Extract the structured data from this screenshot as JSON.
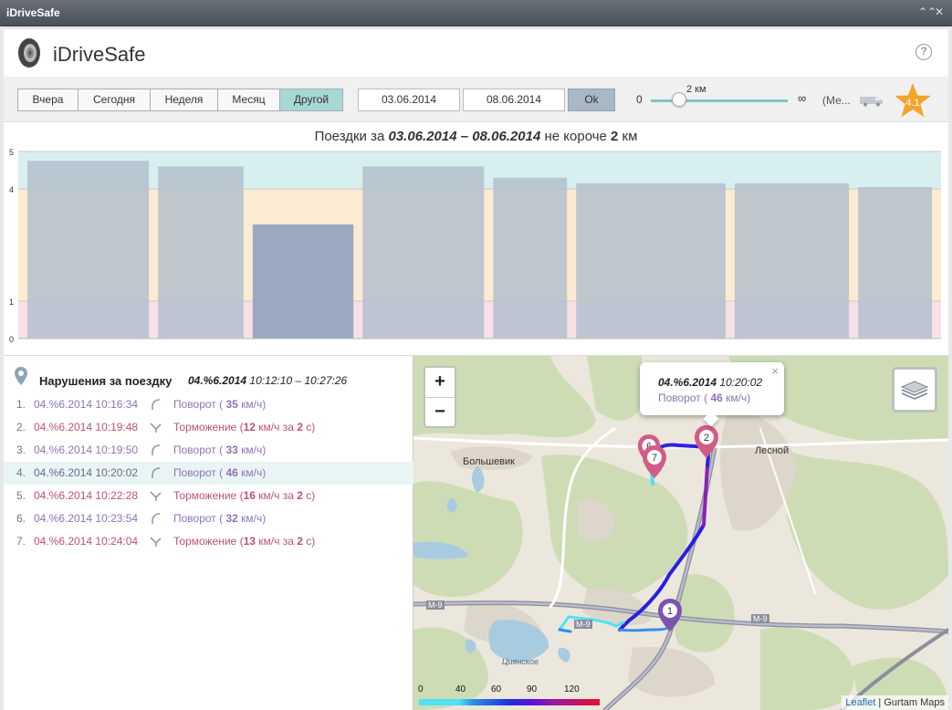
{
  "window": {
    "title": "iDriveSafe",
    "controls": [
      "⌃⌃",
      "✕"
    ]
  },
  "header": {
    "title": "iDriveSafe",
    "help": "?"
  },
  "toolbar": {
    "periods": [
      {
        "label": "Вчера",
        "active": false
      },
      {
        "label": "Сегодня",
        "active": false
      },
      {
        "label": "Неделя",
        "active": false
      },
      {
        "label": "Месяц",
        "active": false
      },
      {
        "label": "Другой",
        "active": true
      }
    ],
    "date_from": "03.06.2014",
    "date_to": "08.06.2014",
    "ok_label": "Ok",
    "slider": {
      "min_label": "0",
      "max_label": "∞",
      "value_label": "2 км",
      "fraction": 0.2
    },
    "vehicle_label": "(Ме...",
    "score": "4.1"
  },
  "chart": {
    "title_prefix": "Поездки за ",
    "title_range": "03.06.2014 – 08.06.2014",
    "title_middle": " не короче ",
    "title_distance": "2",
    "title_suffix": " км"
  },
  "chart_data": {
    "type": "bar",
    "title": "Поездки за 03.06.2014 – 08.06.2014 не короче 2 км",
    "y_ticks": [
      0,
      1,
      4,
      5
    ],
    "ylim": [
      0,
      5
    ],
    "bands": [
      {
        "from": 0,
        "to": 1,
        "color": "#f9dfe6"
      },
      {
        "from": 1,
        "to": 4,
        "color": "#fcebd3"
      },
      {
        "from": 4,
        "to": 5,
        "color": "#d8eff0"
      }
    ],
    "values": [
      4.75,
      4.6,
      3.05,
      4.6,
      4.3,
      4.15,
      4.15,
      4.05
    ],
    "selected_index": 2,
    "bar_color": "#b4bfcd",
    "selected_color": "#9aa9bf"
  },
  "violations": {
    "title": "Нарушения за поездку",
    "trip_date": "04.%6.2014",
    "trip_time": "10:12:10 – 10:27:26",
    "items": [
      {
        "num": "1.",
        "time": "04.%6.2014 10:16:34",
        "kind": "turn",
        "label": "Поворот ( ",
        "value": "35",
        "unit": " км/ч)",
        "extra": "",
        "extra_value": "",
        "extra_tail": ""
      },
      {
        "num": "2.",
        "time": "04.%6.2014 10:19:48",
        "kind": "brake",
        "label": "Торможение (",
        "value": "12",
        "unit": " км/ч за ",
        "extra": "",
        "extra_value": "2",
        "extra_tail": " с)"
      },
      {
        "num": "3.",
        "time": "04.%6.2014 10:19:50",
        "kind": "turn",
        "label": "Поворот ( ",
        "value": "33",
        "unit": " км/ч)",
        "extra": "",
        "extra_value": "",
        "extra_tail": ""
      },
      {
        "num": "4.",
        "time": "04.%6.2014 10:20:02",
        "kind": "turn-sel",
        "label": "Поворот ( ",
        "value": "46",
        "unit": " км/ч)",
        "extra": "",
        "extra_value": "",
        "extra_tail": ""
      },
      {
        "num": "5.",
        "time": "04.%6.2014 10:22:28",
        "kind": "brake",
        "label": "Торможение (",
        "value": "16",
        "unit": " км/ч за ",
        "extra": "",
        "extra_value": "2",
        "extra_tail": " с)"
      },
      {
        "num": "6.",
        "time": "04.%6.2014 10:23:54",
        "kind": "turn",
        "label": "Поворот ( ",
        "value": "32",
        "unit": " км/ч)",
        "extra": "",
        "extra_value": "",
        "extra_tail": ""
      },
      {
        "num": "7.",
        "time": "04.%6.2014 10:24:04",
        "kind": "brake",
        "label": "Торможение (",
        "value": "13",
        "unit": " км/ч за ",
        "extra": "",
        "extra_value": "2",
        "extra_tail": " с)"
      }
    ],
    "selected_index": 3
  },
  "map": {
    "zoom_in": "+",
    "zoom_out": "−",
    "popup": {
      "date": "04.%6.2014",
      "time": " 10:20:02",
      "label": "Поворот ( ",
      "value": "46",
      "unit": " км/ч)",
      "close": "×"
    },
    "places": {
      "bolshevik": "Большевик",
      "lesnoy": "Лесной",
      "tsyanskoe": "Циянское",
      "road1": "М-9",
      "road2": "М-9",
      "road3": "М-9"
    },
    "markers": [
      "2",
      "7",
      "6",
      "1"
    ],
    "speed_legend": [
      "0",
      "40",
      "60",
      "90",
      "120"
    ],
    "attribution": {
      "leaflet": "Leaflet",
      "sep": " | ",
      "source": "Gurtam Maps"
    }
  },
  "colors": {
    "accent": "#a7d9d4",
    "turn": "#8e72b8",
    "brake": "#c0507a",
    "marker": "#d25c88",
    "marker_selected": "#7a55b0"
  }
}
